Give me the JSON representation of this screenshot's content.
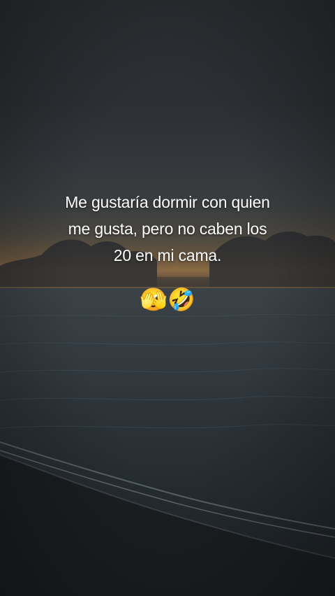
{
  "post": {
    "caption": "Me gustaría dormir con quien\nme gusta, pero no caben los\n20 en mi cama.",
    "emojis": "🫣🤣"
  },
  "background": {
    "scene": "sunset-beach",
    "text_color": "#ffffff"
  }
}
